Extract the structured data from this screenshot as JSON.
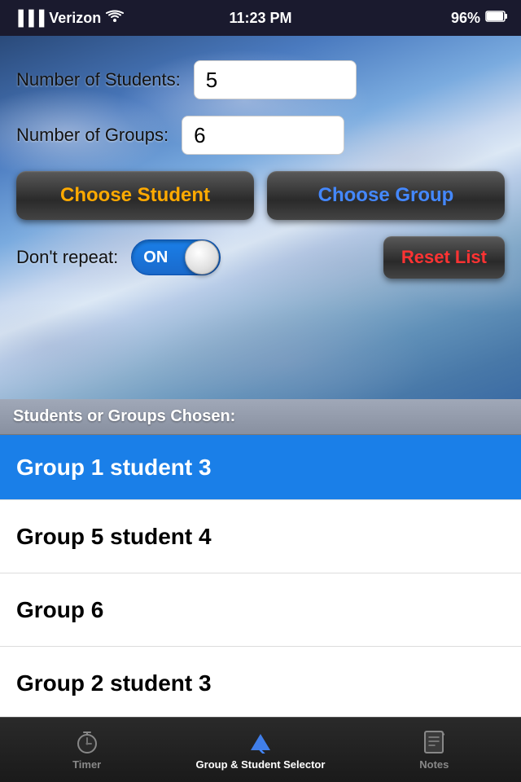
{
  "statusBar": {
    "carrier": "Verizon",
    "time": "11:23 PM",
    "battery": "96%"
  },
  "form": {
    "studentsLabel": "Number of Students:",
    "studentsValue": "5",
    "groupsLabel": "Number of Groups:",
    "groupsValue": "6"
  },
  "buttons": {
    "chooseStudent": "Choose Student",
    "chooseGroup": "Choose Group",
    "resetList": "Reset List"
  },
  "toggle": {
    "label": "Don't repeat:",
    "state": "ON"
  },
  "list": {
    "header": "Students or Groups Chosen:",
    "items": [
      {
        "text": "Group 1 student 3",
        "selected": true
      },
      {
        "text": "Group 5 student 4",
        "selected": false
      },
      {
        "text": "Group 6",
        "selected": false
      },
      {
        "text": "Group 2 student 3",
        "selected": false
      }
    ]
  },
  "tabs": [
    {
      "id": "timer",
      "label": "Timer",
      "active": false
    },
    {
      "id": "group-student-selector",
      "label": "Group & Student Selector",
      "active": true
    },
    {
      "id": "notes",
      "label": "Notes",
      "active": false
    }
  ]
}
